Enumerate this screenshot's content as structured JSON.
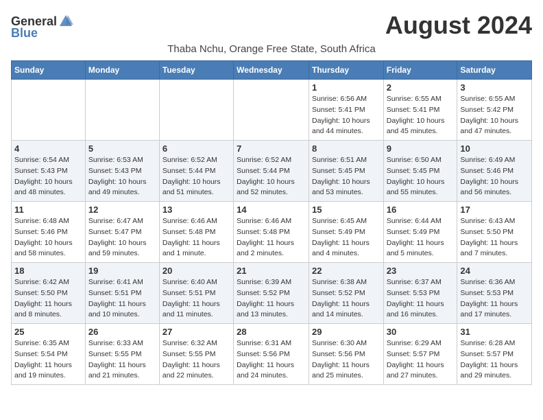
{
  "header": {
    "logo_general": "General",
    "logo_blue": "Blue",
    "month_year": "August 2024",
    "location": "Thaba Nchu, Orange Free State, South Africa"
  },
  "columns": [
    "Sunday",
    "Monday",
    "Tuesday",
    "Wednesday",
    "Thursday",
    "Friday",
    "Saturday"
  ],
  "weeks": [
    [
      {
        "day": "",
        "info": ""
      },
      {
        "day": "",
        "info": ""
      },
      {
        "day": "",
        "info": ""
      },
      {
        "day": "",
        "info": ""
      },
      {
        "day": "1",
        "info": "Sunrise: 6:56 AM\nSunset: 5:41 PM\nDaylight: 10 hours\nand 44 minutes."
      },
      {
        "day": "2",
        "info": "Sunrise: 6:55 AM\nSunset: 5:41 PM\nDaylight: 10 hours\nand 45 minutes."
      },
      {
        "day": "3",
        "info": "Sunrise: 6:55 AM\nSunset: 5:42 PM\nDaylight: 10 hours\nand 47 minutes."
      }
    ],
    [
      {
        "day": "4",
        "info": "Sunrise: 6:54 AM\nSunset: 5:43 PM\nDaylight: 10 hours\nand 48 minutes."
      },
      {
        "day": "5",
        "info": "Sunrise: 6:53 AM\nSunset: 5:43 PM\nDaylight: 10 hours\nand 49 minutes."
      },
      {
        "day": "6",
        "info": "Sunrise: 6:52 AM\nSunset: 5:44 PM\nDaylight: 10 hours\nand 51 minutes."
      },
      {
        "day": "7",
        "info": "Sunrise: 6:52 AM\nSunset: 5:44 PM\nDaylight: 10 hours\nand 52 minutes."
      },
      {
        "day": "8",
        "info": "Sunrise: 6:51 AM\nSunset: 5:45 PM\nDaylight: 10 hours\nand 53 minutes."
      },
      {
        "day": "9",
        "info": "Sunrise: 6:50 AM\nSunset: 5:45 PM\nDaylight: 10 hours\nand 55 minutes."
      },
      {
        "day": "10",
        "info": "Sunrise: 6:49 AM\nSunset: 5:46 PM\nDaylight: 10 hours\nand 56 minutes."
      }
    ],
    [
      {
        "day": "11",
        "info": "Sunrise: 6:48 AM\nSunset: 5:46 PM\nDaylight: 10 hours\nand 58 minutes."
      },
      {
        "day": "12",
        "info": "Sunrise: 6:47 AM\nSunset: 5:47 PM\nDaylight: 10 hours\nand 59 minutes."
      },
      {
        "day": "13",
        "info": "Sunrise: 6:46 AM\nSunset: 5:48 PM\nDaylight: 11 hours\nand 1 minute."
      },
      {
        "day": "14",
        "info": "Sunrise: 6:46 AM\nSunset: 5:48 PM\nDaylight: 11 hours\nand 2 minutes."
      },
      {
        "day": "15",
        "info": "Sunrise: 6:45 AM\nSunset: 5:49 PM\nDaylight: 11 hours\nand 4 minutes."
      },
      {
        "day": "16",
        "info": "Sunrise: 6:44 AM\nSunset: 5:49 PM\nDaylight: 11 hours\nand 5 minutes."
      },
      {
        "day": "17",
        "info": "Sunrise: 6:43 AM\nSunset: 5:50 PM\nDaylight: 11 hours\nand 7 minutes."
      }
    ],
    [
      {
        "day": "18",
        "info": "Sunrise: 6:42 AM\nSunset: 5:50 PM\nDaylight: 11 hours\nand 8 minutes."
      },
      {
        "day": "19",
        "info": "Sunrise: 6:41 AM\nSunset: 5:51 PM\nDaylight: 11 hours\nand 10 minutes."
      },
      {
        "day": "20",
        "info": "Sunrise: 6:40 AM\nSunset: 5:51 PM\nDaylight: 11 hours\nand 11 minutes."
      },
      {
        "day": "21",
        "info": "Sunrise: 6:39 AM\nSunset: 5:52 PM\nDaylight: 11 hours\nand 13 minutes."
      },
      {
        "day": "22",
        "info": "Sunrise: 6:38 AM\nSunset: 5:52 PM\nDaylight: 11 hours\nand 14 minutes."
      },
      {
        "day": "23",
        "info": "Sunrise: 6:37 AM\nSunset: 5:53 PM\nDaylight: 11 hours\nand 16 minutes."
      },
      {
        "day": "24",
        "info": "Sunrise: 6:36 AM\nSunset: 5:53 PM\nDaylight: 11 hours\nand 17 minutes."
      }
    ],
    [
      {
        "day": "25",
        "info": "Sunrise: 6:35 AM\nSunset: 5:54 PM\nDaylight: 11 hours\nand 19 minutes."
      },
      {
        "day": "26",
        "info": "Sunrise: 6:33 AM\nSunset: 5:55 PM\nDaylight: 11 hours\nand 21 minutes."
      },
      {
        "day": "27",
        "info": "Sunrise: 6:32 AM\nSunset: 5:55 PM\nDaylight: 11 hours\nand 22 minutes."
      },
      {
        "day": "28",
        "info": "Sunrise: 6:31 AM\nSunset: 5:56 PM\nDaylight: 11 hours\nand 24 minutes."
      },
      {
        "day": "29",
        "info": "Sunrise: 6:30 AM\nSunset: 5:56 PM\nDaylight: 11 hours\nand 25 minutes."
      },
      {
        "day": "30",
        "info": "Sunrise: 6:29 AM\nSunset: 5:57 PM\nDaylight: 11 hours\nand 27 minutes."
      },
      {
        "day": "31",
        "info": "Sunrise: 6:28 AM\nSunset: 5:57 PM\nDaylight: 11 hours\nand 29 minutes."
      }
    ]
  ]
}
